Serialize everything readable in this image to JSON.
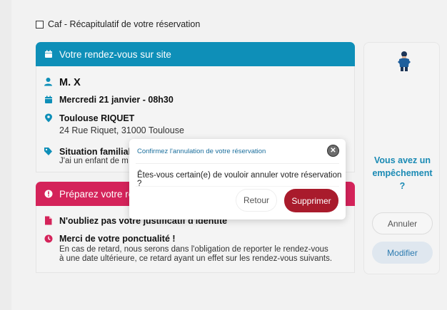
{
  "header": {
    "title": "Caf - Récapitulatif de votre réservation"
  },
  "rdv_card": {
    "title": "Votre rendez-vous sur site",
    "person": "M. X",
    "date": "Mercredi 21 janvier - 08h30",
    "location_name": "Toulouse RIQUET",
    "location_address": "24 Rue Riquet, 31000 Toulouse",
    "situation_label": "Situation familiale",
    "situation_value": "J'ai un enfant de m"
  },
  "prepare_card": {
    "title": "Préparez votre re",
    "item1": "N'oubliez pas votre justificatif d'identité",
    "item2_title": "Merci de votre ponctualité !",
    "item2_line1": "En cas de retard, nous serons dans l'obligation de reporter le rendez-vous",
    "item2_line2": "à une date ultérieure, ce retard ayant un effet sur les rendez-vous suivants."
  },
  "side_panel": {
    "question_line1": "Vous avez un",
    "question_line2": "empêchement",
    "question_line3": "?",
    "annuler_label": "Annuler",
    "modifier_label": "Modifier"
  },
  "modal": {
    "title": "Confirmez l'annulation de votre réservation",
    "message": "Êtes-vous certain(e) de vouloir annuler votre réservation ?",
    "retour_label": "Retour",
    "supprimer_label": "Supprimer",
    "close_symbol": "✕"
  },
  "colors": {
    "primary_blue": "#0e8fb8",
    "alert_pink": "#d4235a",
    "danger_red": "#a91b2c",
    "link_blue": "#1a8ab4"
  }
}
